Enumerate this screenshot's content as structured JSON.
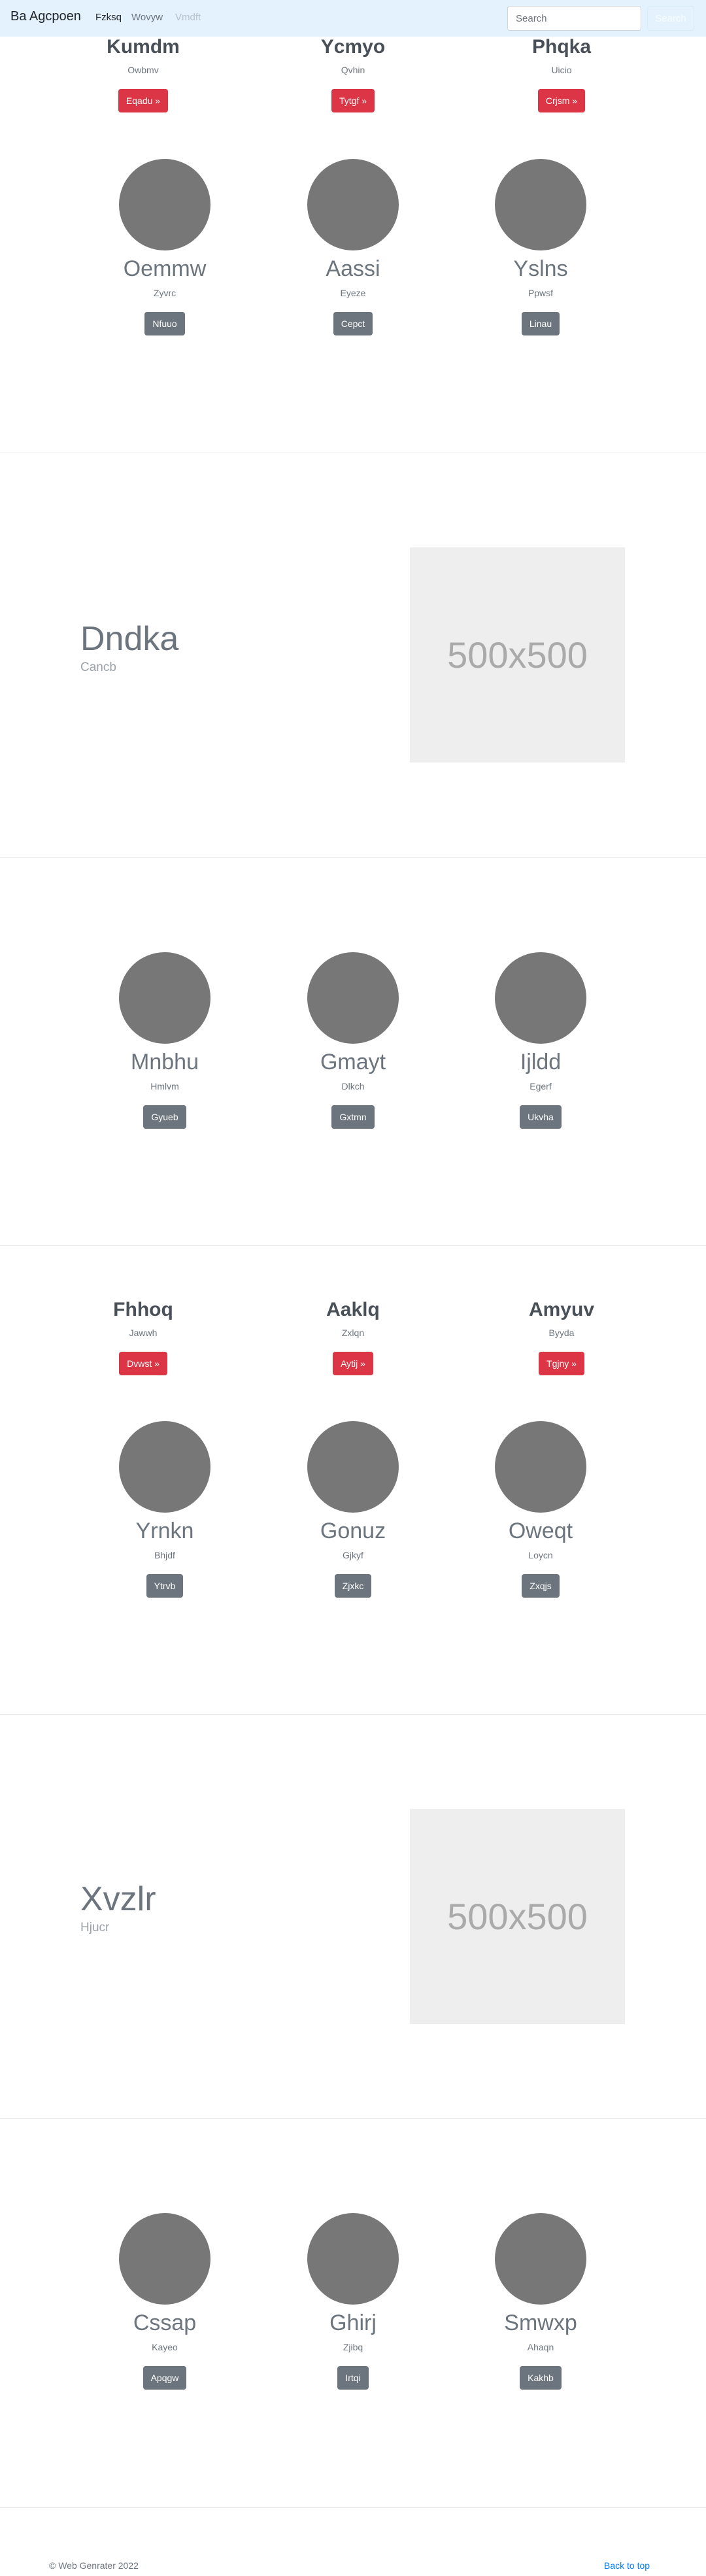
{
  "navbar": {
    "brand": "Ba Agcpoen",
    "links": [
      {
        "label": "Fzksq",
        "state": "active"
      },
      {
        "label": "Wovyw",
        "state": "normal"
      },
      {
        "label": "Vmdft",
        "state": "disabled"
      }
    ],
    "search_placeholder": "Search",
    "search_button": "Search",
    "background_color": "#e3f2fd"
  },
  "section1": {
    "headings": [
      {
        "title": "Kumdm",
        "subtitle": "Owbmv",
        "button": "Eqadu »"
      },
      {
        "title": "Ycmyo",
        "subtitle": "Qvhin",
        "button": "Tytgf »"
      },
      {
        "title": "Phqka",
        "subtitle": "Uicio",
        "button": "Crjsm »"
      }
    ],
    "profiles": [
      {
        "title": "Oemmw",
        "subtitle": "Zyvrc",
        "button": "Nfuuo"
      },
      {
        "title": "Aassi",
        "subtitle": "Eyeze",
        "button": "Cepct"
      },
      {
        "title": "Yslns",
        "subtitle": "Ppwsf",
        "button": "Linau"
      }
    ]
  },
  "feature1": {
    "title": "Dndka",
    "subtitle": "Cancb",
    "image_label": "500x500"
  },
  "section2": {
    "profiles": [
      {
        "title": "Mnbhu",
        "subtitle": "Hmlvm",
        "button": "Gyueb"
      },
      {
        "title": "Gmayt",
        "subtitle": "Dlkch",
        "button": "Gxtmn"
      },
      {
        "title": "Ijldd",
        "subtitle": "Egerf",
        "button": "Ukvha"
      }
    ]
  },
  "section3": {
    "headings": [
      {
        "title": "Fhhoq",
        "subtitle": "Jawwh",
        "button": "Dvwst »"
      },
      {
        "title": "Aaklq",
        "subtitle": "Zxlqn",
        "button": "Aytij »"
      },
      {
        "title": "Amyuv",
        "subtitle": "Byyda",
        "button": "Tgjny »"
      }
    ],
    "profiles": [
      {
        "title": "Yrnkn",
        "subtitle": "Bhjdf",
        "button": "Ytrvb"
      },
      {
        "title": "Gonuz",
        "subtitle": "Gjkyf",
        "button": "Zjxkc"
      },
      {
        "title": "Oweqt",
        "subtitle": "Loycn",
        "button": "Zxqjs"
      }
    ]
  },
  "feature2": {
    "title": "Xvzlr",
    "subtitle": "Hjucr",
    "image_label": "500x500"
  },
  "section4": {
    "profiles": [
      {
        "title": "Cssap",
        "subtitle": "Kayeo",
        "button": "Apqgw"
      },
      {
        "title": "Ghirj",
        "subtitle": "Zjibq",
        "button": "Irtqi"
      },
      {
        "title": "Smwxp",
        "subtitle": "Ahaqn",
        "button": "Kakhb"
      }
    ]
  },
  "footer": {
    "copyright": "© Web Genrater 2022",
    "back_to_top": "Back to top"
  },
  "colors": {
    "primary_button": "#dc3545",
    "secondary_button": "#6c757d",
    "link": "#007bff"
  }
}
